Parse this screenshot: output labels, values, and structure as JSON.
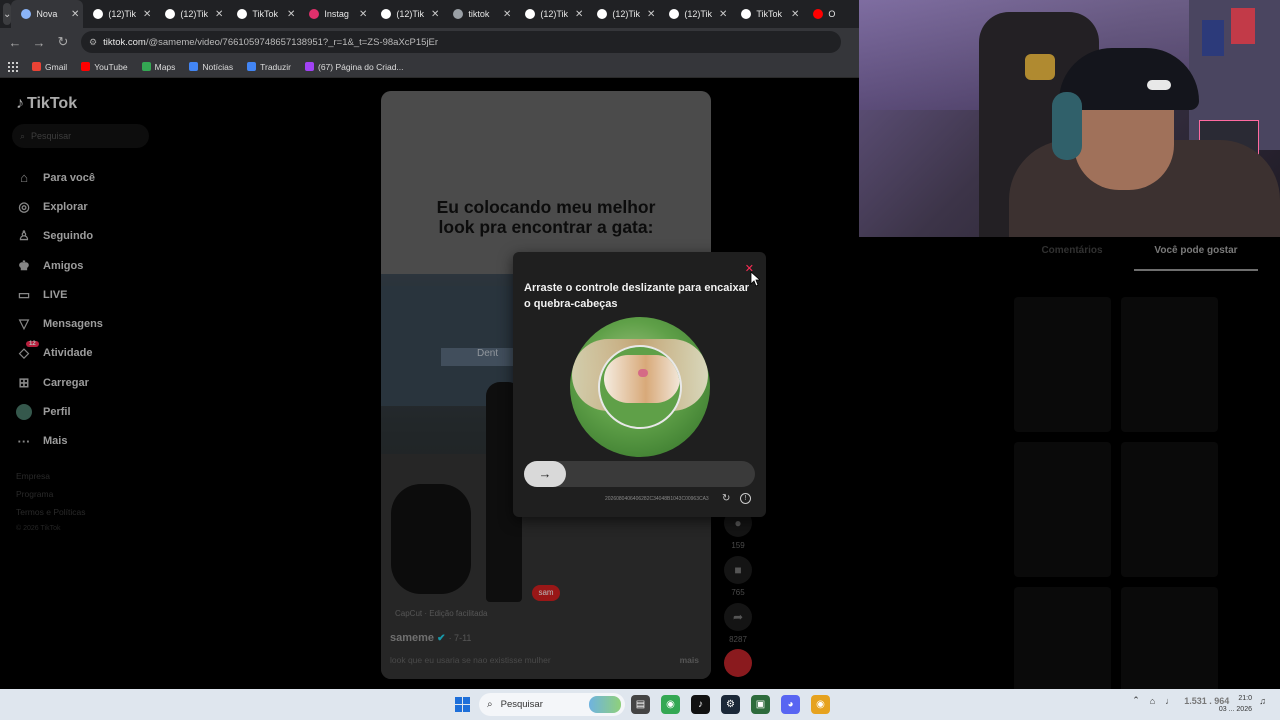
{
  "browser": {
    "tabs": [
      {
        "label": "Nova",
        "color": "#8ab4f8",
        "active": true
      },
      {
        "label": "(12)Tik",
        "color": "#ffffff"
      },
      {
        "label": "(12)Tik",
        "color": "#ffffff"
      },
      {
        "label": "TikTok",
        "color": "#ffffff"
      },
      {
        "label": "Instag",
        "color": "#e1306c"
      },
      {
        "label": "(12)Tik",
        "color": "#ffffff"
      },
      {
        "label": "tiktok",
        "color": "#9aa0a6"
      },
      {
        "label": "(12)Tik",
        "color": "#ffffff"
      },
      {
        "label": "(12)Tik",
        "color": "#ffffff"
      },
      {
        "label": "(12)Tik",
        "color": "#ffffff"
      },
      {
        "label": "TikTok",
        "color": "#ffffff"
      },
      {
        "label": "O",
        "color": "#ff0000"
      }
    ],
    "url_host": "tiktok.com",
    "url_path": "/@sameme/video/7661059748657138951?_r=1&_t=ZS-98aXcP15jEr",
    "bookmarks": [
      {
        "label": "Gmail",
        "color": "#ea4335"
      },
      {
        "label": "YouTube",
        "color": "#ff0000"
      },
      {
        "label": "Maps",
        "color": "#34a853"
      },
      {
        "label": "Notícias",
        "color": "#4285f4"
      },
      {
        "label": "Traduzir",
        "color": "#4285f4"
      },
      {
        "label": "(67) Página do Criad...",
        "color": "#a142f4"
      }
    ]
  },
  "tiktok": {
    "logo": "TikTok",
    "search_placeholder": "Pesquisar",
    "nav": [
      {
        "label": "Para você",
        "icon": "home-icon",
        "glyph": "⌂"
      },
      {
        "label": "Explorar",
        "icon": "compass-icon",
        "glyph": "◎"
      },
      {
        "label": "Seguindo",
        "icon": "following-icon",
        "glyph": "♙"
      },
      {
        "label": "Amigos",
        "icon": "friends-icon",
        "glyph": "♚"
      },
      {
        "label": "LIVE",
        "icon": "live-icon",
        "glyph": "▭"
      },
      {
        "label": "Mensagens",
        "icon": "messages-icon",
        "glyph": "▽"
      },
      {
        "label": "Atividade",
        "icon": "activity-icon",
        "glyph": "◇",
        "badge": "12"
      },
      {
        "label": "Carregar",
        "icon": "upload-icon",
        "glyph": "⊞"
      },
      {
        "label": "Perfil",
        "icon": "avatar"
      },
      {
        "label": "Mais",
        "icon": "more-icon",
        "glyph": "···"
      }
    ],
    "footer": [
      "Empresa",
      "Programa",
      "Termos e Políticas",
      "© 2026 TikTok"
    ],
    "video": {
      "caption_line1": "Eu colocando meu melhor",
      "caption_line2": "look pra encontrar a gata:",
      "store_sign": "Dent",
      "watermark": "sam",
      "capcut": "CapCut · Edição facilitada",
      "author": "sameme",
      "date": "· 7-11",
      "description": "look que eu usaria se nao existisse mulher",
      "more": "mais"
    },
    "actions": [
      {
        "icon": "comment-icon",
        "glyph": "●",
        "count": "159"
      },
      {
        "icon": "bookmark-icon",
        "glyph": "■",
        "count": "765"
      },
      {
        "icon": "share-icon",
        "glyph": "➦",
        "count": "8287"
      }
    ],
    "right_tabs": [
      "Comentários",
      "Você pode gostar"
    ]
  },
  "captcha": {
    "title": "Arraste o controle deslizante para encaixar o quebra-cabeças",
    "close": "✕",
    "slider_arrow": "→",
    "id": "2026080406406282C34048B1043C00963CA3",
    "refresh": "↻",
    "info": "!"
  },
  "taskbar": {
    "search_placeholder": "Pesquisar",
    "apps": [
      {
        "icon": "file-explorer-icon",
        "glyph": "▤",
        "color": "#444444"
      },
      {
        "icon": "chrome-icon",
        "glyph": "◉",
        "color": "#34a853"
      },
      {
        "icon": "tiktok-icon",
        "glyph": "♪",
        "color": "#111111"
      },
      {
        "icon": "steam-icon",
        "glyph": "⚙",
        "color": "#1b2838"
      },
      {
        "icon": "terminal-icon",
        "glyph": "▣",
        "color": "#2d6b3c"
      },
      {
        "icon": "discord-icon",
        "glyph": "◕",
        "color": "#5865f2"
      },
      {
        "icon": "chrome-canary-icon",
        "glyph": "◉",
        "color": "#e6a21f"
      }
    ],
    "clock_time": "21:0",
    "clock_date": "03 ... 2026",
    "overlay_text": "1.531 . 964"
  }
}
